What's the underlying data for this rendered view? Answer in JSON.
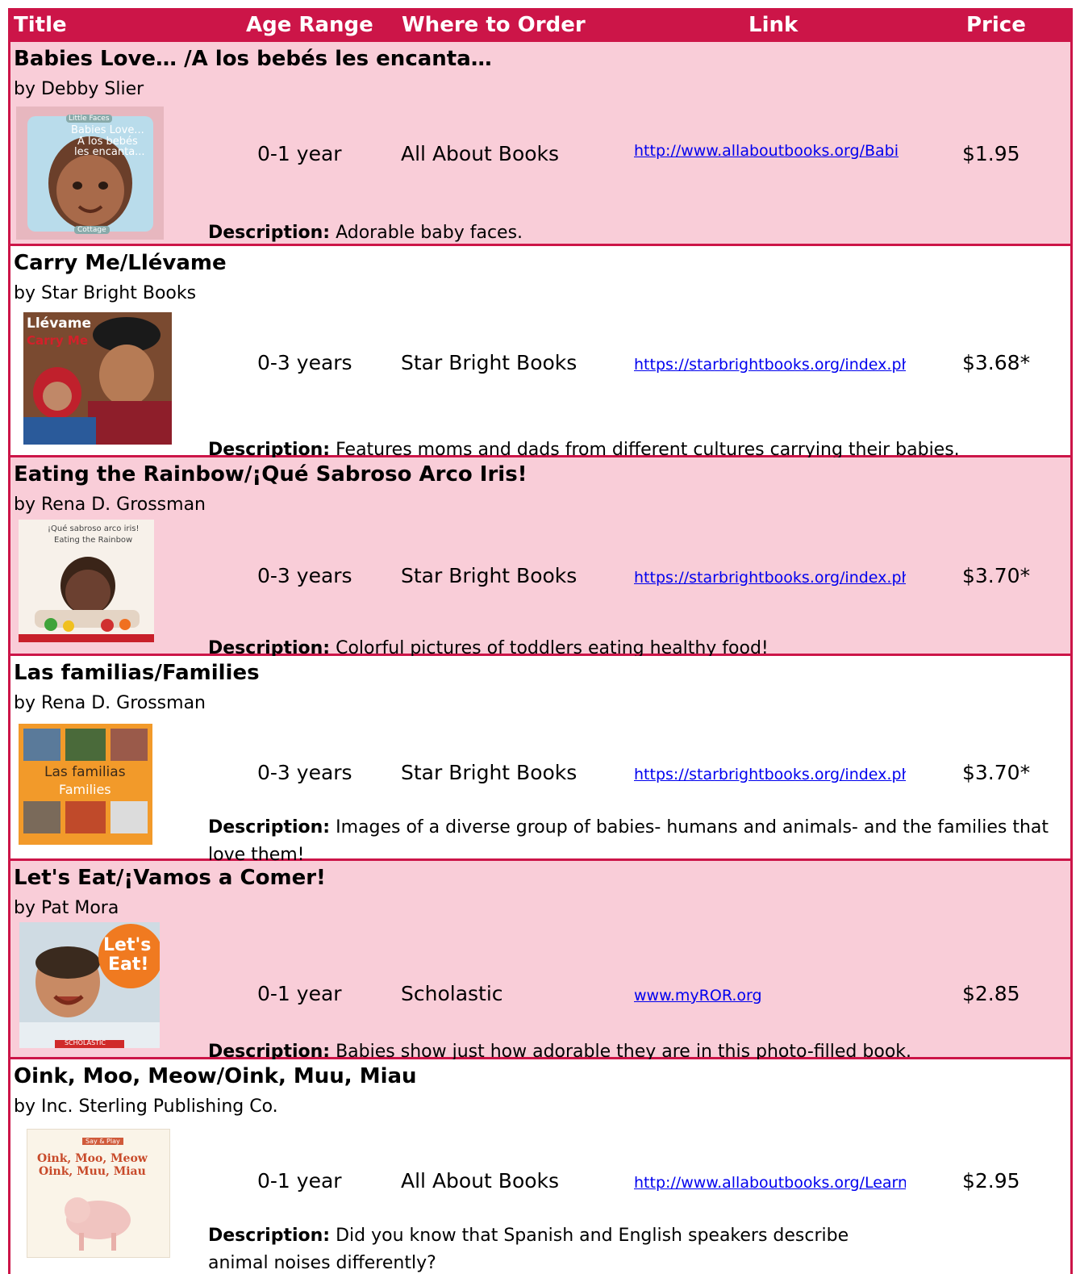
{
  "header": {
    "title": "Title",
    "age": "Age Range",
    "where": "Where to Order",
    "link": "Link",
    "price": "Price"
  },
  "colors": {
    "accent": "#cc1548",
    "row_pink": "#f9cdd8",
    "link": "#0000ee"
  },
  "books": [
    {
      "title": "Babies Love… /A los bebés les encanta…",
      "author": "by Debby Slier",
      "age": "0-1 year",
      "where": "All About Books",
      "link": "http://www.allaboutbooks.org/Babi",
      "price": "$1.95",
      "desc_label": "Description:",
      "desc": " Adorable baby faces.",
      "cover_text": [
        "Little Faces",
        "Babies Love...",
        "A los bebés",
        "les encanta...",
        "Cottage"
      ]
    },
    {
      "title": "Carry Me/Llévame",
      "author": "by Star Bright Books",
      "age": "0-3 years",
      "where": "Star Bright Books",
      "link": "https://starbrightbooks.org/index.php?",
      "price": "$3.68*",
      "desc_label": "Description:",
      "desc": " Features moms and dads from different cultures carrying their babies.",
      "cover_text": [
        "Llévame",
        "Carry Me"
      ]
    },
    {
      "title": "Eating the Rainbow/¡Qué Sabroso Arco Iris!",
      "author": "by Rena D. Grossman",
      "age": "0-3 years",
      "where": "Star Bright Books",
      "link": "https://starbrightbooks.org/index.php?",
      "price": "$3.70*",
      "desc_label": "Description:",
      "desc": " Colorful pictures of toddlers eating healthy food!",
      "cover_text": [
        "¡Qué sabroso arco iris!",
        "Eating the Rainbow"
      ]
    },
    {
      "title": "Las familias/Families",
      "author": "by Rena D. Grossman",
      "age": "0-3 years",
      "where": "Star Bright Books",
      "link": "https://starbrightbooks.org/index.php?",
      "price": "$3.70*",
      "desc_label": "Description:",
      "desc": " Images of a diverse group of babies- humans and animals- and the families that love them!",
      "cover_text": [
        "Las familias",
        "Families"
      ]
    },
    {
      "title": "Let's Eat/¡Vamos a Comer!",
      "author": "by Pat Mora",
      "age": "0-1 year",
      "where": "Scholastic",
      "link": "www.myROR.org",
      "price": "$2.85",
      "desc_label": "Description:",
      "desc": " Babies show just how adorable they are in this photo-filled book.",
      "cover_text": [
        "Let's",
        "Eat!",
        "SCHOLASTIC"
      ]
    },
    {
      "title": "Oink, Moo, Meow/Oink, Muu, Miau",
      "author": "by Inc. Sterling Publishing Co.",
      "age": "0-1 year",
      "where": "All About Books",
      "link": "http://www.allaboutbooks.org/Learn-a",
      "price": "$2.95",
      "desc_label": "Description:",
      "desc": " Did you know that Spanish and English speakers describe animal noises differently?",
      "cover_text": [
        "Say & Play",
        "Oink, Moo, Meow",
        "Oink, Muu, Miau"
      ]
    }
  ]
}
